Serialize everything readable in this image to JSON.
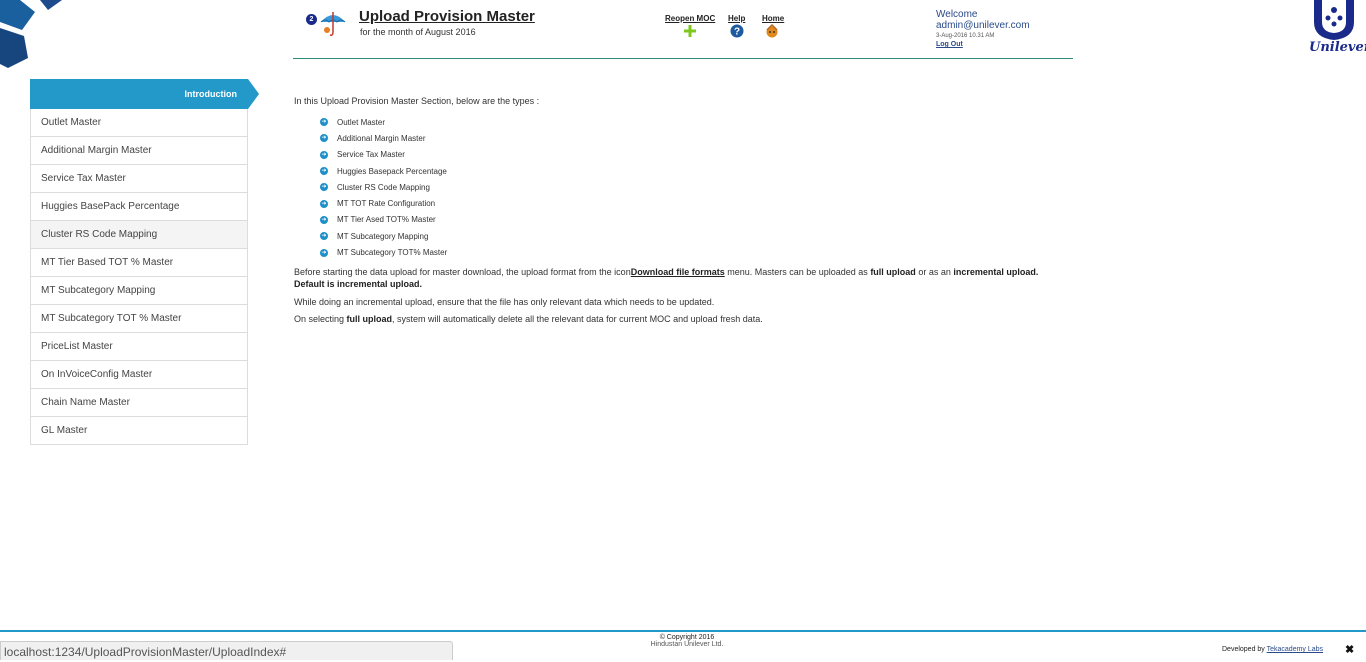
{
  "header": {
    "badge_count": "2",
    "title": "Upload Provision Master",
    "subtitle": "for the month of August 2016",
    "nav": [
      {
        "label": "Reopen MOC",
        "icon": "plus-icon"
      },
      {
        "label": "Help",
        "icon": "help-icon"
      },
      {
        "label": "Home",
        "icon": "home-icon"
      }
    ],
    "user": {
      "welcome": "Welcome",
      "email": "admin@unilever.com",
      "datetime": "3-Aug-2016 10.31 AM",
      "logout": "Log Out"
    },
    "brand": "Unilever"
  },
  "sidebar": {
    "active": "Introduction",
    "items": [
      "Outlet Master",
      "Additional Margin Master",
      "Service Tax Master",
      "Huggies BasePack Percentage",
      "Cluster RS Code Mapping",
      "MT Tier Based TOT % Master",
      "MT Subcategory Mapping",
      "MT Subcategory TOT % Master",
      "PriceList Master",
      "On InVoiceConfig Master",
      "Chain Name Master",
      "GL Master"
    ]
  },
  "main": {
    "intro": "In this Upload Provision Master Section, below are the types :",
    "types": [
      "Outlet Master",
      "Additional Margin Master",
      "Service Tax Master",
      "Huggies Basepack Percentage",
      "Cluster RS Code Mapping",
      "MT TOT Rate Configuration",
      "MT Tier Ased TOT% Master",
      "MT Subcategory Mapping",
      "MT Subcategory TOT% Master"
    ],
    "para1_a": "Before starting the data upload for master download, the upload format from the icon",
    "para1_link": "Download file formats",
    "para1_b": " menu. Masters can be uploaded as ",
    "para1_full": "full upload",
    "para1_c": " or as an ",
    "para1_incr": "incremental upload.",
    "para1_default": "Default is incremental upload.",
    "para2": "While doing an incremental upload, ensure that the file has only relevant data which needs to be updated.",
    "para3_a": "On selecting ",
    "para3_full": "full upload",
    "para3_b": ", system will automatically delete all the relevant data for current MOC and upload fresh data."
  },
  "footer": {
    "status_url": "localhost:1234/UploadProvisionMaster/UploadIndex#",
    "copyright": "© Copyright 2016",
    "company": "Hindustan Unilever Ltd.",
    "developed_by": "Developed by ",
    "developer": "Tekacademy Labs"
  },
  "colors": {
    "accent": "#2299c9",
    "header_rule": "#2e8b7a",
    "brand_blue": "#1a2a8a"
  }
}
